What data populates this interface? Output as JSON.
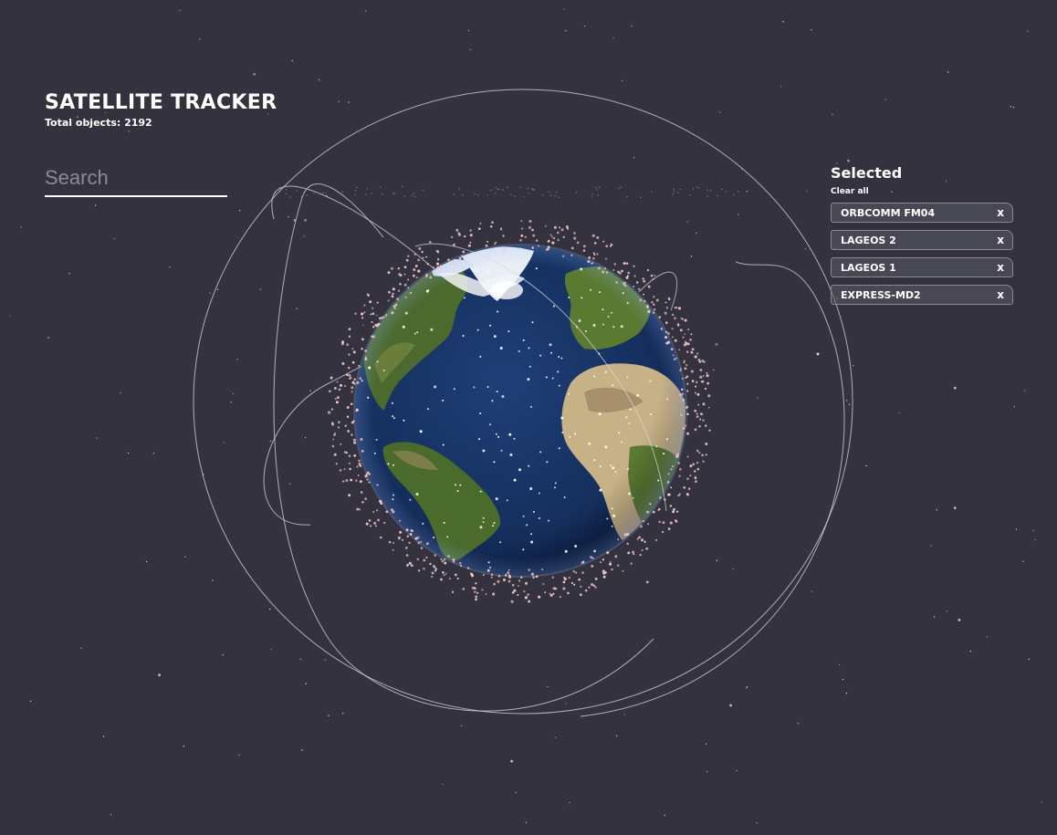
{
  "header": {
    "title": "SATELLITE TRACKER",
    "total_objects_text": "Total objects: 2192"
  },
  "search": {
    "placeholder": "Search",
    "value": ""
  },
  "selected": {
    "title": "Selected",
    "clear_all_label": "Clear all",
    "remove_label": "x",
    "items": [
      {
        "name": "ORBCOMM FM04"
      },
      {
        "name": "LAGEOS 2"
      },
      {
        "name": "LAGEOS 1"
      },
      {
        "name": "EXPRESS-MD2"
      }
    ]
  },
  "colors": {
    "background": "#33323e",
    "orbit_line": "#d8d8e0",
    "ocean": "#1c3566",
    "land": "#4f6a2f",
    "desert": "#c9b48a",
    "cloud": "#ffffff",
    "debris": "#f3c9c9"
  },
  "icons": {
    "remove": "close-x-icon"
  }
}
